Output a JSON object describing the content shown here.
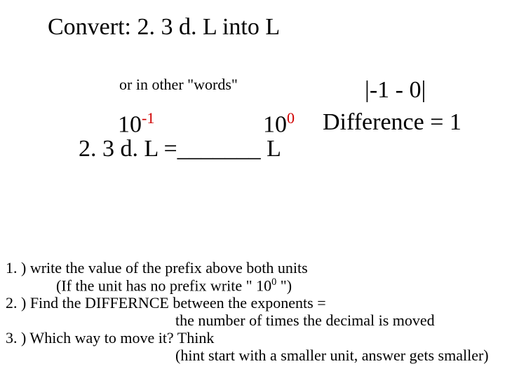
{
  "title": "Convert:   2. 3 d. L into L",
  "sub": "or in other \"words\"",
  "eq": {
    "ten_a": "10",
    "exp_a": "-1",
    "ten_b": "10",
    "exp_b": "0",
    "line": "2. 3 d. L =_______ L"
  },
  "diff": {
    "abs_open": "|",
    "abs_inner": "-1 - 0",
    "abs_close": "|",
    "label": "Difference = 1"
  },
  "instr": {
    "l1": "1. ) write the value of the prefix above both units",
    "l2": "(If the unit has no prefix write \" 10",
    "l2_exp": "0",
    "l2_tail": " \")",
    "l3": "2. ) Find the DIFFERNCE between the exponents =",
    "l4": "the number of times the decimal is moved",
    "l5": "3. ) Which way to move it? Think",
    "l6": "(hint start with a smaller unit, answer gets smaller)"
  }
}
